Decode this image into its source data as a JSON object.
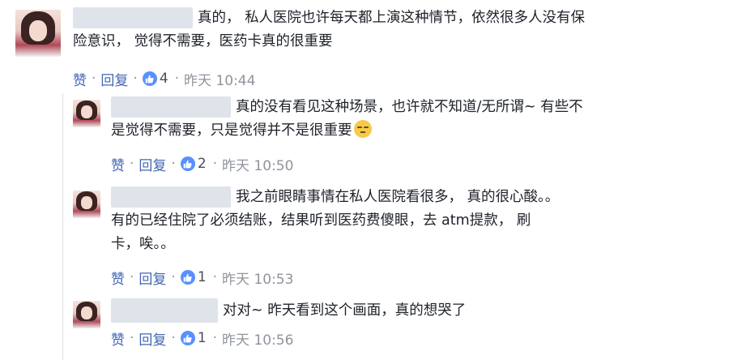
{
  "comments": [
    {
      "lines": [
        "真的， 私人医院也许每天都上演这种情节，依然很多人没有保",
        "险意识， 觉得不需要，医药卡真的很重要"
      ],
      "actions": {
        "like": "赞",
        "reply": "回复",
        "count": "4",
        "time": "昨天 10:44"
      }
    },
    {
      "lines": [
        "真的没有看见这种场景，也许就不知道/无所谓~ 有些不",
        "是觉得不需要，只是觉得并不是很重要"
      ],
      "emoji": "relieved-face-icon",
      "actions": {
        "like": "赞",
        "reply": "回复",
        "count": "2",
        "time": "昨天 10:50"
      }
    },
    {
      "lines": [
        "我之前眼睛事情在私人医院看很多， 真的很心酸。。",
        "有的已经住院了必须结账，结果听到医药费傻眼，去 atm提款， 刷",
        "卡，唉。。"
      ],
      "actions": {
        "like": "赞",
        "reply": "回复",
        "count": "1",
        "time": "昨天 10:53"
      }
    },
    {
      "lines": [
        "对对~ 昨天看到这个画面，真的想哭了"
      ],
      "actions": {
        "like": "赞",
        "reply": "回复",
        "count": "1",
        "time": "昨天 10:56"
      }
    }
  ],
  "colors": {
    "link": "#4267b2",
    "like_badge": "#5890ff",
    "muted": "#90949c"
  }
}
